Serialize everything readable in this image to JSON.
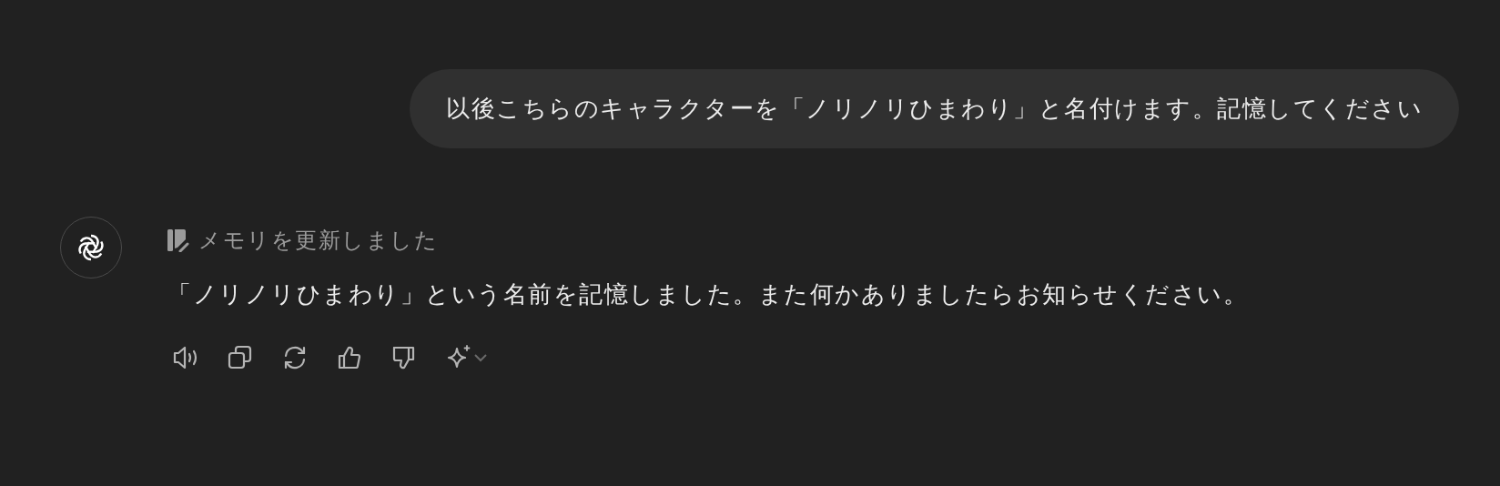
{
  "user_message": {
    "text": "以後こちらのキャラクターを「ノリノリひまわり」と名付けます。記憶してください"
  },
  "assistant_message": {
    "memory_status": "メモリを更新しました",
    "text": "「ノリノリひまわり」という名前を記憶しました。また何かありましたらお知らせください。"
  }
}
